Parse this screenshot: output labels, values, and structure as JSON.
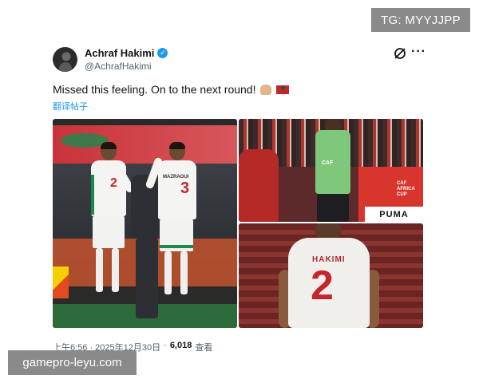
{
  "watermarks": {
    "top_right": "TG: MYYJJPP",
    "bottom_left": "gamepro-leyu.com"
  },
  "tweet": {
    "display_name": "Achraf Hakimi",
    "handle": "@AchrafHakimi",
    "verified": true,
    "text": "Missed this feeling. On to the next round!",
    "emoji": [
      "flexed-biceps",
      "morocco-flag"
    ],
    "translate_label": "翻译帖子",
    "timestamp": "上午6:56 · 2025年12月30日",
    "separator": "·",
    "views_count": "6,018",
    "views_label": "查看"
  },
  "photos": {
    "photo1": {
      "player_left_number": "2",
      "player_right_name": "MAZRAOUI",
      "player_right_number": "3"
    },
    "photo2": {
      "vest_label": "CAF",
      "board_brand": "PUMA",
      "board_text": [
        "CAF",
        "AFRICA CUP"
      ]
    },
    "photo3": {
      "shirt_name": "HAKIMI",
      "shirt_number": "2"
    }
  },
  "colors": {
    "verified": "#1d9bf0",
    "link": "#1d9bf0",
    "text": "#0f1419",
    "muted": "#536471",
    "morocco_red": "#c1272d",
    "morocco_green": "#006233"
  }
}
